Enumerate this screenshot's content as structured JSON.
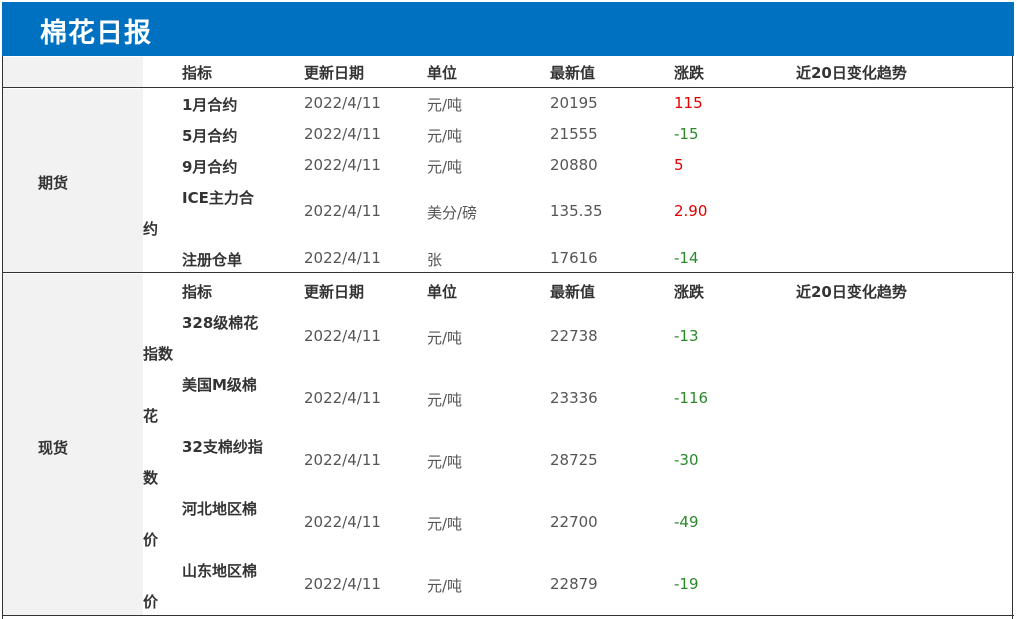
{
  "title": "棉花日报",
  "headers": [
    "指标",
    "更新日期",
    "单位",
    "最新值",
    "涨跌",
    "近20日变化趋势"
  ],
  "sections": [
    {
      "category": "期货",
      "rows": [
        {
          "name_line1": "1月合约",
          "name_line2": "",
          "date": "2022/4/11",
          "unit": "元/吨",
          "value": "20195",
          "change": "115",
          "direction": "up"
        },
        {
          "name_line1": "5月合约",
          "name_line2": "",
          "date": "2022/4/11",
          "unit": "元/吨",
          "value": "21555",
          "change": "-15",
          "direction": "down"
        },
        {
          "name_line1": "9月合约",
          "name_line2": "",
          "date": "2022/4/11",
          "unit": "元/吨",
          "value": "20880",
          "change": "5",
          "direction": "up"
        },
        {
          "name_line1": "ICE主力合",
          "name_line2": "约",
          "date": "2022/4/11",
          "unit": "美分/磅",
          "value": "135.35",
          "change": "2.90",
          "direction": "up"
        },
        {
          "name_line1": "注册仓单",
          "name_line2": "",
          "date": "2022/4/11",
          "unit": "张",
          "value": "17616",
          "change": "-14",
          "direction": "down"
        }
      ]
    },
    {
      "category": "现货",
      "rows": [
        {
          "name_line1": "328级棉花",
          "name_line2": "指数",
          "date": "2022/4/11",
          "unit": "元/吨",
          "value": "22738",
          "change": "-13",
          "direction": "down"
        },
        {
          "name_line1": "美国M级棉",
          "name_line2": "花",
          "date": "2022/4/11",
          "unit": "元/吨",
          "value": "23336",
          "change": "-116",
          "direction": "down"
        },
        {
          "name_line1": "32支棉纱指",
          "name_line2": "数",
          "date": "2022/4/11",
          "unit": "元/吨",
          "value": "28725",
          "change": "-30",
          "direction": "down"
        },
        {
          "name_line1": "河北地区棉",
          "name_line2": "价",
          "date": "2022/4/11",
          "unit": "元/吨",
          "value": "22700",
          "change": "-49",
          "direction": "down"
        },
        {
          "name_line1": "山东地区棉",
          "name_line2": "价",
          "date": "2022/4/11",
          "unit": "元/吨",
          "value": "22879",
          "change": "-19",
          "direction": "down"
        }
      ]
    }
  ],
  "colors": {
    "header_bg": "#0070c0",
    "up": "#e00000",
    "down": "#2a8a2a",
    "category_bg": "#f2f2f2"
  }
}
